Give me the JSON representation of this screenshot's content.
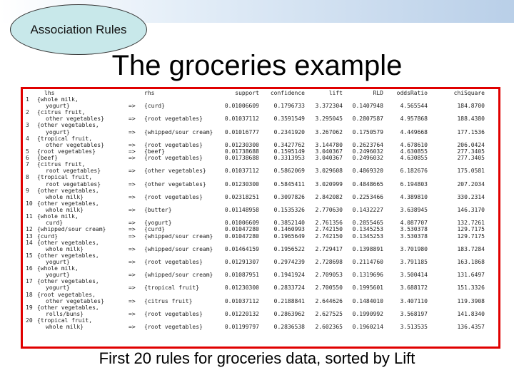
{
  "header": {
    "badge": "Association Rules",
    "title": "The groceries example"
  },
  "caption": "First 20 rules for groceries data, sorted by Lift",
  "table": {
    "columns": [
      "lhs",
      "rhs",
      "support",
      "confidence",
      "lift",
      "RLD",
      "oddsRatio",
      "chiSquare"
    ],
    "arrow": "=>",
    "rows": [
      {
        "n": "1",
        "lhs": [
          "{whole milk,",
          "yogurt}"
        ],
        "rhs": "{curd}",
        "v": [
          "0.01006609",
          "0.1796733",
          "3.372304",
          "0.1407948",
          "4.565544",
          "184.8700"
        ]
      },
      {
        "n": "2",
        "lhs": [
          "{citrus fruit,",
          "other vegetables}"
        ],
        "rhs": "{root vegetables}",
        "v": [
          "0.01037112",
          "0.3591549",
          "3.295045",
          "0.2807587",
          "4.957868",
          "188.4380"
        ]
      },
      {
        "n": "3",
        "lhs": [
          "{other vegetables,",
          "yogurt}"
        ],
        "rhs": "{whipped/sour cream}",
        "v": [
          "0.01016777",
          "0.2341920",
          "3.267062",
          "0.1750579",
          "4.449668",
          "177.1536"
        ]
      },
      {
        "n": "4",
        "lhs": [
          "{tropical fruit,",
          "other vegetables}"
        ],
        "rhs": "{root vegetables}",
        "v": [
          "0.01230300",
          "0.3427762",
          "3.144780",
          "0.2623764",
          "4.678610",
          "206.0424"
        ]
      },
      {
        "n": "5",
        "lhs": [
          "{root vegetables}"
        ],
        "rhs": "{beef}",
        "v": [
          "0.01738688",
          "0.1595149",
          "3.040367",
          "0.2496032",
          "4.630855",
          "277.3405"
        ]
      },
      {
        "n": "6",
        "lhs": [
          "{beef}"
        ],
        "rhs": "{root vegetables}",
        "v": [
          "0.01738688",
          "0.3313953",
          "3.040367",
          "0.2496032",
          "4.630855",
          "277.3405"
        ]
      },
      {
        "n": "7",
        "lhs": [
          "{citrus fruit,",
          "root vegetables}"
        ],
        "rhs": "{other vegetables}",
        "v": [
          "0.01037112",
          "0.5862069",
          "3.029608",
          "0.4869320",
          "6.182676",
          "175.0581"
        ]
      },
      {
        "n": "8",
        "lhs": [
          "{tropical fruit,",
          "root vegetables}"
        ],
        "rhs": "{other vegetables}",
        "v": [
          "0.01230300",
          "0.5845411",
          "3.020999",
          "0.4848665",
          "6.194803",
          "207.2034"
        ]
      },
      {
        "n": "9",
        "lhs": [
          "{other vegetables,",
          "whole milk}"
        ],
        "rhs": "{root vegetables}",
        "v": [
          "0.02318251",
          "0.3097826",
          "2.842082",
          "0.2253466",
          "4.389810",
          "330.2314"
        ]
      },
      {
        "n": "10",
        "lhs": [
          "{other vegetables,",
          "whole milk}"
        ],
        "rhs": "{butter}",
        "v": [
          "0.01148958",
          "0.1535326",
          "2.770630",
          "0.1432227",
          "3.638945",
          "146.3170"
        ]
      },
      {
        "n": "11",
        "lhs": [
          "{whole milk,",
          "curd}"
        ],
        "rhs": "{yogurt}",
        "v": [
          "0.01006609",
          "0.3852140",
          "2.761356",
          "0.2855465",
          "4.087707",
          "132.7261"
        ]
      },
      {
        "n": "12",
        "lhs": [
          "{whipped/sour cream}"
        ],
        "rhs": "{curd}",
        "v": [
          "0.01047280",
          "0.1460993",
          "2.742150",
          "0.1345253",
          "3.530378",
          "129.7175"
        ]
      },
      {
        "n": "13",
        "lhs": [
          "{curd}"
        ],
        "rhs": "{whipped/sour cream}",
        "v": [
          "0.01047280",
          "0.1965649",
          "2.742150",
          "0.1345253",
          "3.530378",
          "129.7175"
        ]
      },
      {
        "n": "14",
        "lhs": [
          "{other vegetables,",
          "whole milk}"
        ],
        "rhs": "{whipped/sour cream}",
        "v": [
          "0.01464159",
          "0.1956522",
          "2.729417",
          "0.1398891",
          "3.701980",
          "183.7284"
        ]
      },
      {
        "n": "15",
        "lhs": [
          "{other vegetables,",
          "yogurt}"
        ],
        "rhs": "{root vegetables}",
        "v": [
          "0.01291307",
          "0.2974239",
          "2.728698",
          "0.2114760",
          "3.791185",
          "163.1868"
        ]
      },
      {
        "n": "16",
        "lhs": [
          "{whole milk,",
          "yogurt}"
        ],
        "rhs": "{whipped/sour cream}",
        "v": [
          "0.01087951",
          "0.1941924",
          "2.709053",
          "0.1319696",
          "3.500414",
          "131.6497"
        ]
      },
      {
        "n": "17",
        "lhs": [
          "{other vegetables,",
          "yogurt}"
        ],
        "rhs": "{tropical fruit}",
        "v": [
          "0.01230300",
          "0.2833724",
          "2.700550",
          "0.1995601",
          "3.688172",
          "151.3326"
        ]
      },
      {
        "n": "18",
        "lhs": [
          "{root vegetables,",
          "other vegetables}"
        ],
        "rhs": "{citrus fruit}",
        "v": [
          "0.01037112",
          "0.2188841",
          "2.644626",
          "0.1484010",
          "3.407110",
          "119.3908"
        ]
      },
      {
        "n": "19",
        "lhs": [
          "{other vegetables,",
          "rolls/buns}"
        ],
        "rhs": "{root vegetables}",
        "v": [
          "0.01220132",
          "0.2863962",
          "2.627525",
          "0.1990992",
          "3.568197",
          "141.8340"
        ]
      },
      {
        "n": "20",
        "lhs": [
          "{tropical fruit,",
          "whole milk}"
        ],
        "rhs": "{root vegetables}",
        "v": [
          "0.01199797",
          "0.2836538",
          "2.602365",
          "0.1960214",
          "3.513535",
          "136.4357"
        ]
      }
    ]
  }
}
